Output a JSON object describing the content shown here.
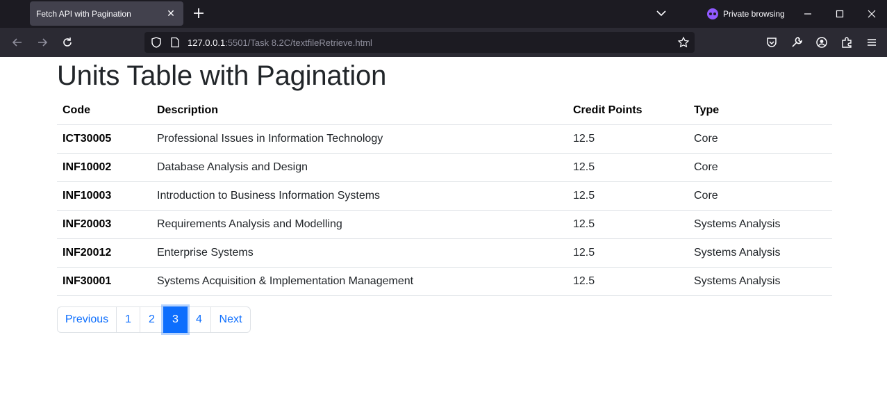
{
  "browser": {
    "tab_title": "Fetch API with Pagination",
    "private_label": "Private browsing",
    "url_host": "127.0.0.1",
    "url_rest": ":5501/Task 8.2C/textfileRetrieve.html"
  },
  "page": {
    "title": "Units Table with Pagination",
    "columns": [
      "Code",
      "Description",
      "Credit Points",
      "Type"
    ],
    "rows": [
      [
        "ICT30005",
        "Professional Issues in Information Technology",
        "12.5",
        "Core"
      ],
      [
        "INF10002",
        "Database Analysis and Design",
        "12.5",
        "Core"
      ],
      [
        "INF10003",
        "Introduction to Business Information Systems",
        "12.5",
        "Core"
      ],
      [
        "INF20003",
        "Requirements Analysis and Modelling",
        "12.5",
        "Systems Analysis"
      ],
      [
        "INF20012",
        "Enterprise Systems",
        "12.5",
        "Systems Analysis"
      ],
      [
        "INF30001",
        "Systems Acquisition & Implementation Management",
        "12.5",
        "Systems Analysis"
      ]
    ],
    "pagination": {
      "previous": "Previous",
      "pages": [
        "1",
        "2",
        "3",
        "4"
      ],
      "active_page": "3",
      "next": "Next"
    }
  },
  "colors": {
    "accent": "#0d6efd",
    "chrome_dark": "#1c1b22",
    "private_purple": "#9059ff"
  }
}
